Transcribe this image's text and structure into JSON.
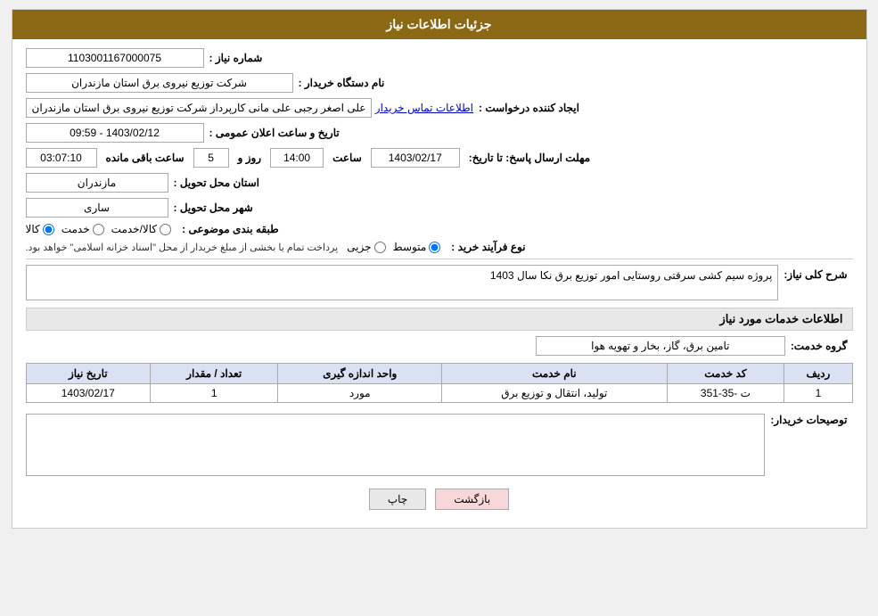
{
  "header": {
    "title": "جزئیات اطلاعات نیاز"
  },
  "fields": {
    "need_number_label": "شماره نیاز :",
    "need_number_value": "1103001167000075",
    "buyer_org_label": "نام دستگاه خریدار :",
    "buyer_org_value": "شرکت توزیع نیروی برق استان مازندران",
    "requester_label": "ایجاد کننده درخواست :",
    "requester_value": "علی اصغر رجبی علی مانی کارپرداز شرکت توزیع نیروی برق استان مازندران",
    "requester_link": "اطلاعات تماس خریدار",
    "announcement_label": "تاریخ و ساعت اعلان عمومی :",
    "announcement_value": "1403/02/12 - 09:59",
    "deadline_label": "مهلت ارسال پاسخ: تا تاریخ:",
    "deadline_date": "1403/02/17",
    "deadline_time_label": "ساعت",
    "deadline_time": "14:00",
    "deadline_days_label": "روز و",
    "deadline_days": "5",
    "remaining_label": "ساعت باقی مانده",
    "remaining_value": "03:07:10",
    "province_label": "استان محل تحویل :",
    "province_value": "مازندران",
    "city_label": "شهر محل تحویل :",
    "city_value": "ساری",
    "category_label": "طبقه بندی موضوعی :",
    "category_options": [
      "کالا",
      "خدمت",
      "کالا/خدمت"
    ],
    "category_selected": "کالا",
    "purchase_type_label": "نوع فرآیند خرید :",
    "purchase_type_options": [
      "جزیی",
      "متوسط"
    ],
    "purchase_type_selected": "متوسط",
    "purchase_notice": "پرداخت تمام یا بخشی از مبلغ خریدار از محل \"اسناد خزانه اسلامی\" خواهد بود.",
    "description_label": "شرح کلی نیاز:",
    "description_value": "پروژه سیم کشی سرقتی روستایی امور توزیع برق نکا سال 1403",
    "service_info_title": "اطلاعات خدمات مورد نیاز",
    "service_group_label": "گروه خدمت:",
    "service_group_value": "تامین برق، گاز، بخار و تهویه هوا",
    "table_headers": [
      "ردیف",
      "کد خدمت",
      "نام خدمت",
      "واحد اندازه گیری",
      "تعداد / مقدار",
      "تاریخ نیاز"
    ],
    "table_rows": [
      {
        "row": "1",
        "code": "ت -35-351",
        "name": "تولید، انتقال و توزیع برق",
        "unit": "مورد",
        "quantity": "1",
        "date": "1403/02/17"
      }
    ],
    "buyer_desc_label": "توصیحات خریدار:",
    "buyer_desc_value": ""
  },
  "buttons": {
    "print": "چاپ",
    "back": "بازگشت"
  }
}
